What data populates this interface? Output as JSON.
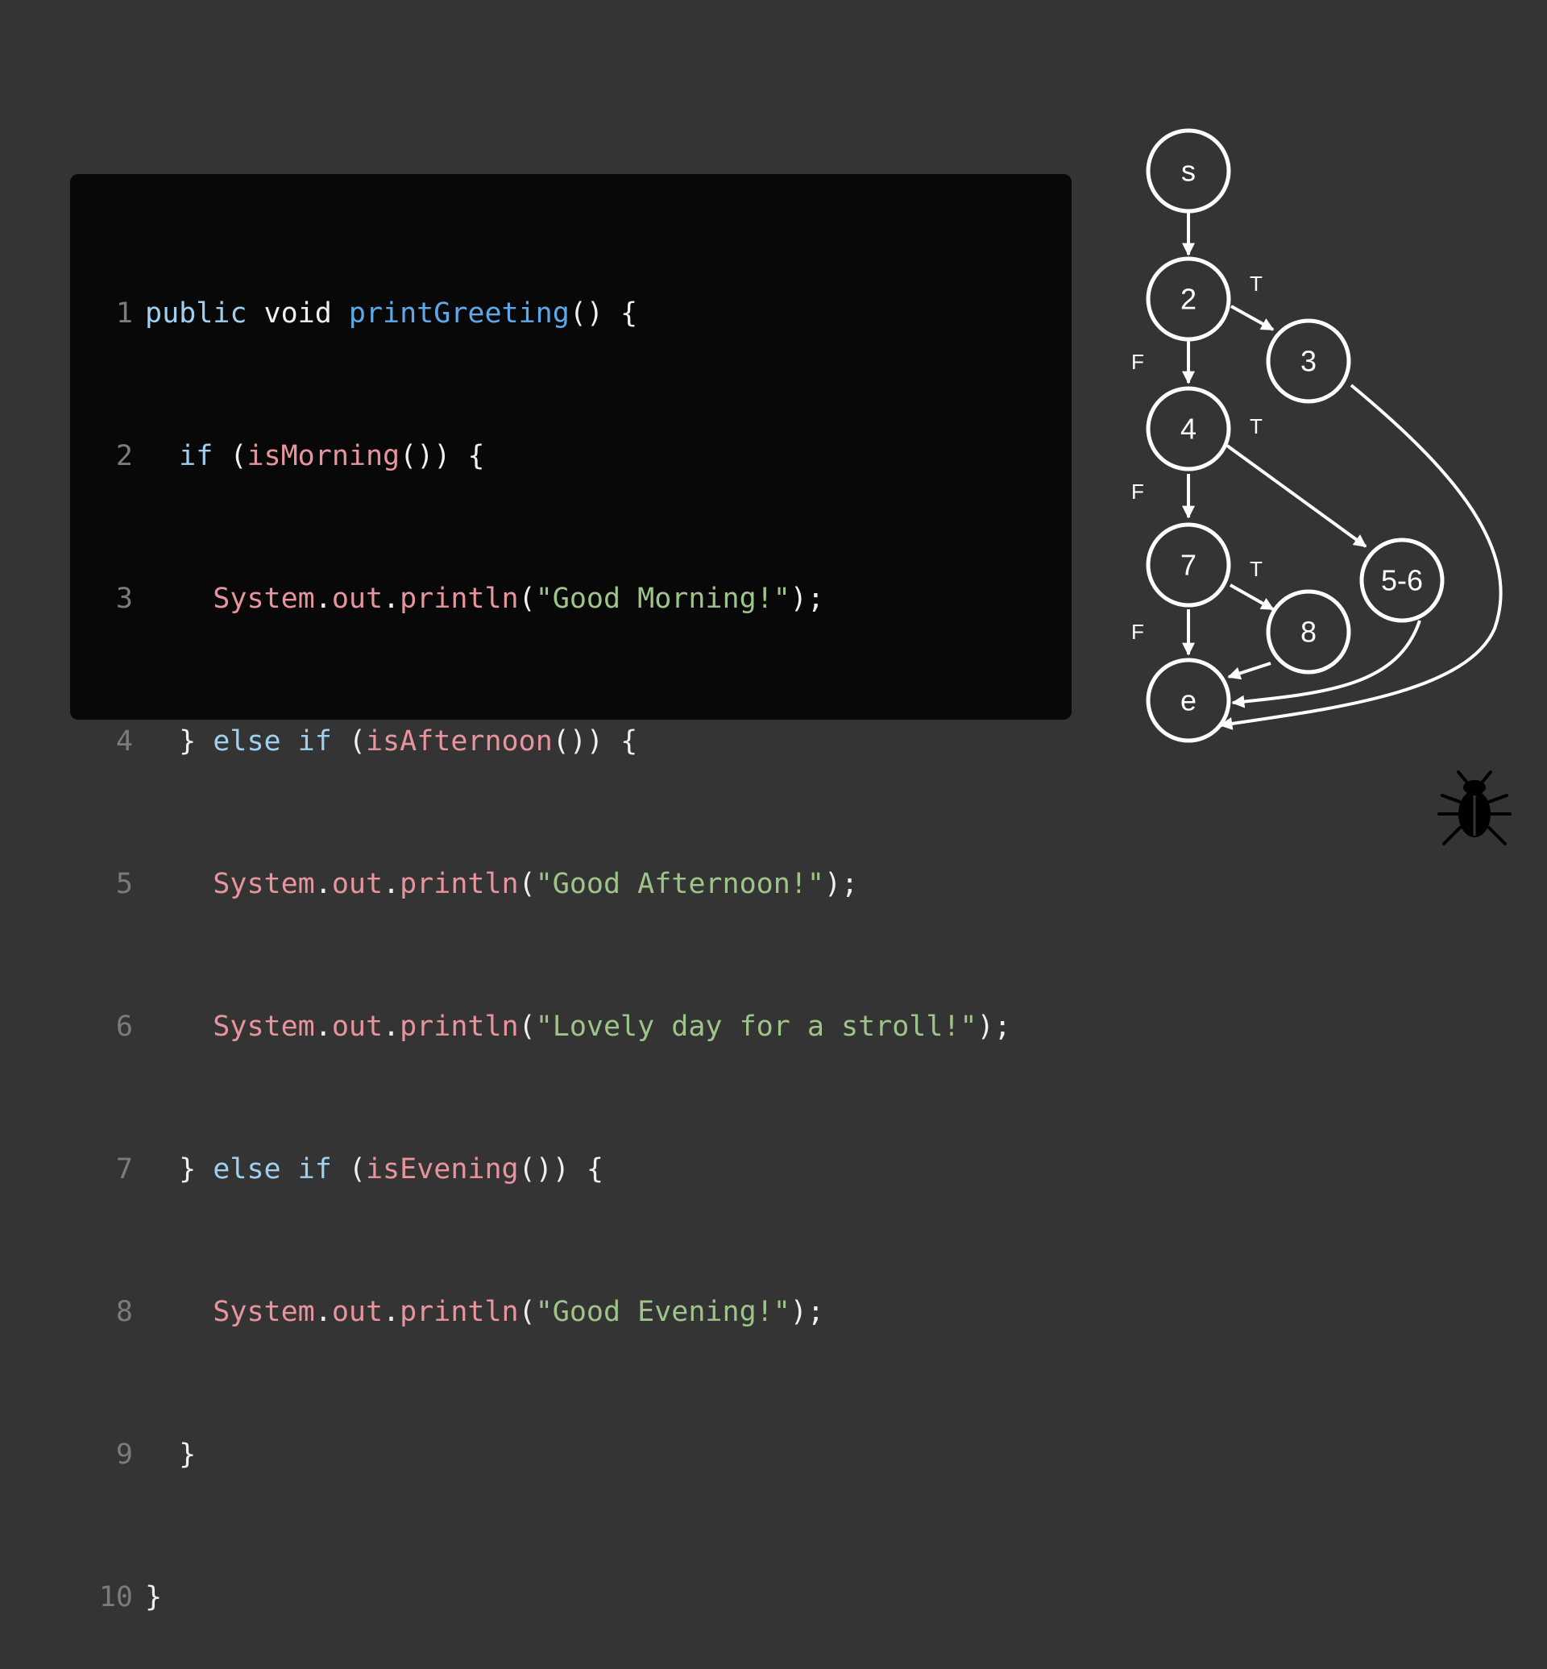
{
  "code": {
    "lines": [
      {
        "num": "1",
        "tokens": [
          {
            "t": "public",
            "c": "kw"
          },
          {
            "t": " ",
            "c": "pl"
          },
          {
            "t": "void",
            "c": "pl"
          },
          {
            "t": " ",
            "c": "pl"
          },
          {
            "t": "printGreeting",
            "c": "fn"
          },
          {
            "t": "() {",
            "c": "pl"
          }
        ]
      },
      {
        "num": "2",
        "tokens": [
          {
            "t": "  ",
            "c": "pl"
          },
          {
            "t": "if",
            "c": "kw"
          },
          {
            "t": " (",
            "c": "pl"
          },
          {
            "t": "isMorning",
            "c": "cl"
          },
          {
            "t": "()) {",
            "c": "pl"
          }
        ]
      },
      {
        "num": "3",
        "tokens": [
          {
            "t": "    ",
            "c": "pl"
          },
          {
            "t": "System",
            "c": "cl"
          },
          {
            "t": ".",
            "c": "pl"
          },
          {
            "t": "out",
            "c": "cl"
          },
          {
            "t": ".",
            "c": "pl"
          },
          {
            "t": "println",
            "c": "cl"
          },
          {
            "t": "(",
            "c": "pl"
          },
          {
            "t": "\"Good Morning!\"",
            "c": "str"
          },
          {
            "t": ");",
            "c": "pl"
          }
        ]
      },
      {
        "num": "4",
        "tokens": [
          {
            "t": "  } ",
            "c": "pl"
          },
          {
            "t": "else",
            "c": "kw"
          },
          {
            "t": " ",
            "c": "pl"
          },
          {
            "t": "if",
            "c": "kw"
          },
          {
            "t": " (",
            "c": "pl"
          },
          {
            "t": "isAfternoon",
            "c": "cl"
          },
          {
            "t": "()) {",
            "c": "pl"
          }
        ]
      },
      {
        "num": "5",
        "tokens": [
          {
            "t": "    ",
            "c": "pl"
          },
          {
            "t": "System",
            "c": "cl"
          },
          {
            "t": ".",
            "c": "pl"
          },
          {
            "t": "out",
            "c": "cl"
          },
          {
            "t": ".",
            "c": "pl"
          },
          {
            "t": "println",
            "c": "cl"
          },
          {
            "t": "(",
            "c": "pl"
          },
          {
            "t": "\"Good Afternoon!\"",
            "c": "str"
          },
          {
            "t": ");",
            "c": "pl"
          }
        ]
      },
      {
        "num": "6",
        "tokens": [
          {
            "t": "    ",
            "c": "pl"
          },
          {
            "t": "System",
            "c": "cl"
          },
          {
            "t": ".",
            "c": "pl"
          },
          {
            "t": "out",
            "c": "cl"
          },
          {
            "t": ".",
            "c": "pl"
          },
          {
            "t": "println",
            "c": "cl"
          },
          {
            "t": "(",
            "c": "pl"
          },
          {
            "t": "\"Lovely day for a stroll!\"",
            "c": "str"
          },
          {
            "t": ");",
            "c": "pl"
          }
        ]
      },
      {
        "num": "7",
        "tokens": [
          {
            "t": "  } ",
            "c": "pl"
          },
          {
            "t": "else",
            "c": "kw"
          },
          {
            "t": " ",
            "c": "pl"
          },
          {
            "t": "if",
            "c": "kw"
          },
          {
            "t": " (",
            "c": "pl"
          },
          {
            "t": "isEvening",
            "c": "cl"
          },
          {
            "t": "()) {",
            "c": "pl"
          }
        ]
      },
      {
        "num": "8",
        "tokens": [
          {
            "t": "    ",
            "c": "pl"
          },
          {
            "t": "System",
            "c": "cl"
          },
          {
            "t": ".",
            "c": "pl"
          },
          {
            "t": "out",
            "c": "cl"
          },
          {
            "t": ".",
            "c": "pl"
          },
          {
            "t": "println",
            "c": "cl"
          },
          {
            "t": "(",
            "c": "pl"
          },
          {
            "t": "\"Good Evening!\"",
            "c": "str"
          },
          {
            "t": ");",
            "c": "pl"
          }
        ]
      },
      {
        "num": "9",
        "tokens": [
          {
            "t": "  }",
            "c": "pl"
          }
        ]
      },
      {
        "num": "10",
        "tokens": [
          {
            "t": "}",
            "c": "pl"
          }
        ]
      }
    ]
  },
  "graph": {
    "nodes": {
      "s": "s",
      "n2": "2",
      "n3": "3",
      "n4": "4",
      "n56": "5-6",
      "n7": "7",
      "n8": "8",
      "e": "e"
    },
    "edge_labels": {
      "n2_true": "T",
      "n2_false": "F",
      "n4_true": "T",
      "n4_false": "F",
      "n7_true": "T",
      "n7_false": "F"
    }
  },
  "logo": {
    "icon": "bug-icon"
  },
  "colors": {
    "background": "#343434",
    "code_panel": "#080808",
    "keyword": "#9fd0f0",
    "function": "#5fa8e8",
    "call": "#e8949c",
    "string": "#9ec48a",
    "line_number": "#7b7b7b"
  }
}
